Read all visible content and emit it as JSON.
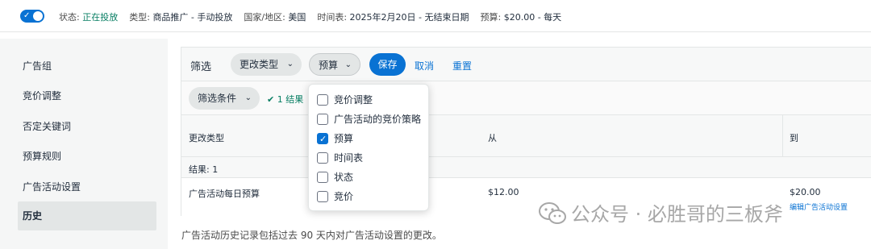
{
  "topbar": {
    "status_label": "状态:",
    "status_value": "正在投放",
    "type_label": "类型:",
    "type_value": "商品推广 - 手动投放",
    "country_label": "国家/地区:",
    "country_value": "美国",
    "schedule_label": "时间表:",
    "schedule_value": "2025年2月20日 - 无结束日期",
    "budget_label": "预算:",
    "budget_value": "$20.00 - 每天"
  },
  "sidebar": {
    "items": [
      {
        "label": "广告组"
      },
      {
        "label": "竞价调整"
      },
      {
        "label": "否定关键词"
      },
      {
        "label": "预算规则"
      },
      {
        "label": "广告活动设置"
      },
      {
        "label": "历史"
      }
    ],
    "active": "历史"
  },
  "filterbar": {
    "label": "筛选",
    "change_type_label": "更改类型",
    "budget_label": "预算",
    "save_label": "保存",
    "cancel_label": "取消",
    "reset_label": "重置"
  },
  "subbar": {
    "filter_conditions_label": "筛选条件",
    "results_label": "✔ 1 结果"
  },
  "table": {
    "headers": {
      "change_type": "更改类型",
      "from": "从",
      "to": "到"
    },
    "group_label": "结果: 1",
    "rows": [
      {
        "change_type": "广告活动每日预算",
        "from": "$12.00",
        "to": "$20.00",
        "edit_link": "编辑广告活动设置"
      }
    ]
  },
  "dropdown": {
    "options": [
      {
        "label": "竞价调整",
        "checked": false
      },
      {
        "label": "广告活动的竞价策略",
        "checked": false
      },
      {
        "label": "预算",
        "checked": true
      },
      {
        "label": "时间表",
        "checked": false
      },
      {
        "label": "状态",
        "checked": false
      },
      {
        "label": "竞价",
        "checked": false
      }
    ]
  },
  "footnote": "广告活动历史记录包括过去 90 天内对广告活动设置的更改。",
  "watermark": {
    "text": "公众号 · 必胜哥的三板斧"
  },
  "colors": {
    "accent": "#0972d3",
    "success": "#067d62",
    "sidebar_bg": "#f5f6f6"
  }
}
